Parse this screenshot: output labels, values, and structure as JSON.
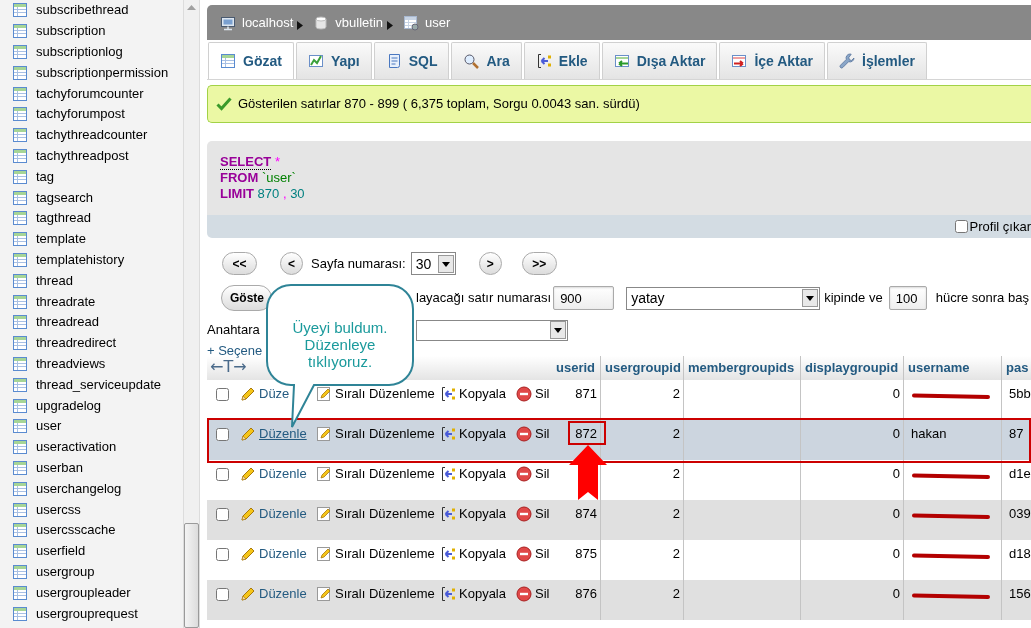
{
  "sidebar": {
    "tables": [
      "subscribethread",
      "subscription",
      "subscriptionlog",
      "subscriptionpermission",
      "tachyforumcounter",
      "tachyforumpost",
      "tachythreadcounter",
      "tachythreadpost",
      "tag",
      "tagsearch",
      "tagthread",
      "template",
      "templatehistory",
      "thread",
      "threadrate",
      "threadread",
      "threadredirect",
      "threadviews",
      "thread_serviceupdate",
      "upgradelog",
      "user",
      "useractivation",
      "userban",
      "userchangelog",
      "usercss",
      "usercsscache",
      "userfield",
      "usergroup",
      "usergroupleader",
      "usergrouprequest"
    ]
  },
  "breadcrumb": [
    {
      "kind": "server",
      "label": "localhost"
    },
    {
      "kind": "database",
      "label": "vbulletin"
    },
    {
      "kind": "table",
      "label": "user"
    }
  ],
  "tabs": [
    {
      "label": "Gözat",
      "selected": true
    },
    {
      "label": "Yapı",
      "selected": false
    },
    {
      "label": "SQL",
      "selected": false
    },
    {
      "label": "Ara",
      "selected": false
    },
    {
      "label": "Ekle",
      "selected": false
    },
    {
      "label": "Dışa Aktar",
      "selected": false
    },
    {
      "label": "İçe Aktar",
      "selected": false
    },
    {
      "label": "İşlemler",
      "selected": false
    }
  ],
  "message": {
    "kind": "success",
    "text": "Gösterilen satırlar 870 - 899 ( 6,375 toplam, Sorgu 0.0043 san. sürdü)"
  },
  "sql_query": {
    "lines": [
      [
        {
          "kind": "doc_keyword",
          "text": "SELECT"
        },
        {
          "kind": "operator",
          "text": "*"
        }
      ],
      [
        {
          "kind": "keyword",
          "text": "FROM"
        },
        {
          "kind": "identifier",
          "text": "`user`"
        }
      ],
      [
        {
          "kind": "keyword",
          "text": "LIMIT"
        },
        {
          "kind": "number",
          "text": "870"
        },
        {
          "kind": "operator",
          "text": ","
        },
        {
          "kind": "number",
          "text": "30"
        }
      ]
    ]
  },
  "profiling": {
    "label": "Profil çıkar",
    "checked": false
  },
  "pager": {
    "first": "<<",
    "previous": "<",
    "page_label": "Sayfa numarası:",
    "page": "30",
    "next": ">",
    "last": ">>"
  },
  "display_form": [
    {
      "kind": "button",
      "text": "Göste"
    },
    {
      "kind": "text",
      "text": "layacağı satır numarası"
    },
    {
      "kind": "input",
      "value": "900"
    },
    {
      "kind": "select",
      "value": "yatay"
    },
    {
      "kind": "text",
      "text": "kipinde ve"
    },
    {
      "kind": "input",
      "value": "100"
    },
    {
      "kind": "text",
      "text": "hücre sonra baş"
    }
  ],
  "sort_form": {
    "label": "Anahtara"
  },
  "options_link": "+ Seçene",
  "table": {
    "text_toggle": "←T→",
    "columns": [
      "userid",
      "usergroupid",
      "membergroupids",
      "displaygroupid",
      "username",
      "pas"
    ],
    "rows": [
      {
        "checked": false,
        "highlighted": false,
        "framed": false,
        "actions": [
          "Düze",
          "Sıralı Düzenleme",
          "Kopyala",
          "Sil"
        ],
        "userid": "871",
        "usergroupid": "2",
        "displaygroupid": "0",
        "redacted": true,
        "pas": "5bb"
      },
      {
        "checked": false,
        "highlighted": true,
        "framed": true,
        "actions": [
          "Düzenle",
          "Sıralı Düzenleme",
          "Kopyala",
          "Sil"
        ],
        "userid": "872",
        "usergroupid": "2",
        "displaygroupid": "0",
        "redacted": false,
        "username": "hakan",
        "pas": "87"
      },
      {
        "checked": false,
        "highlighted": false,
        "framed": false,
        "actions": [
          "Düzenle",
          "Sıralı Düzenleme",
          "Kopyala",
          "Sil"
        ],
        "usergroupid": "2",
        "displaygroupid": "0",
        "redacted": true,
        "pas": "d1e"
      },
      {
        "checked": false,
        "highlighted": false,
        "framed": false,
        "actions": [
          "Düzenle",
          "Sıralı Düzenleme",
          "Kopyala",
          "Sil"
        ],
        "userid": "874",
        "usergroupid": "2",
        "displaygroupid": "0",
        "redacted": true,
        "pas": "039"
      },
      {
        "checked": false,
        "highlighted": false,
        "framed": false,
        "actions": [
          "Düzenle",
          "Sıralı Düzenleme",
          "Kopyala",
          "Sil"
        ],
        "userid": "875",
        "usergroupid": "2",
        "displaygroupid": "0",
        "redacted": true,
        "pas": "d18"
      },
      {
        "checked": false,
        "highlighted": false,
        "framed": false,
        "actions": [
          "Düzenle",
          "Sıralı Düzenleme",
          "Kopyala",
          "Sil"
        ],
        "userid": "876",
        "usergroupid": "2",
        "displaygroupid": "0",
        "redacted": true,
        "pas": "156"
      }
    ]
  },
  "callout": {
    "text": "Üyeyi buldum. Düzenleye tıklıyoruz."
  }
}
